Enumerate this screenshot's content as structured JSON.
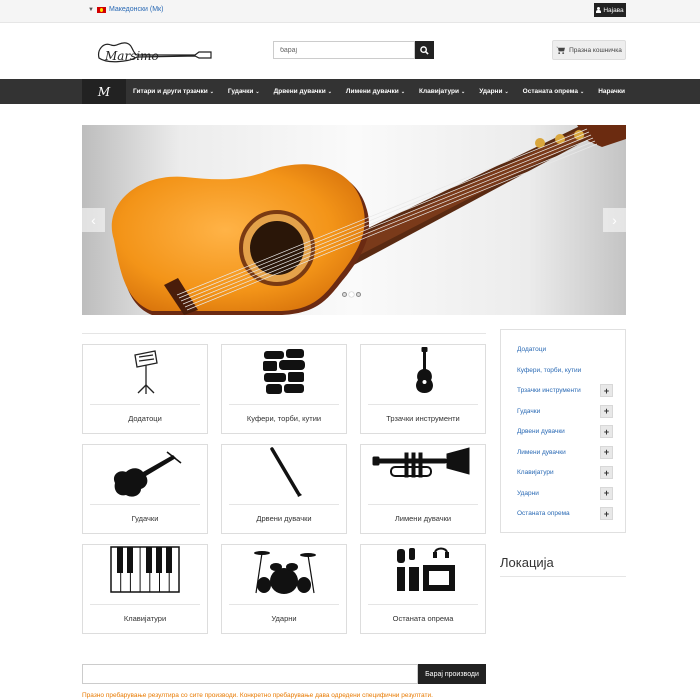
{
  "topbar": {
    "language": "Македонски (Mк)",
    "login_label": "Најава"
  },
  "header": {
    "logo_text": "Marsimo",
    "search_placeholder": "барај",
    "cart_label": "Празна кошничка"
  },
  "nav": {
    "logo_text": "M",
    "items": [
      {
        "label": "Гитари и други трзачки",
        "has_dropdown": true
      },
      {
        "label": "Гудачки",
        "has_dropdown": true
      },
      {
        "label": "Дрвени дувачки",
        "has_dropdown": true
      },
      {
        "label": "Лимени дувачки",
        "has_dropdown": true
      },
      {
        "label": "Клавијатури",
        "has_dropdown": true
      },
      {
        "label": "Ударни",
        "has_dropdown": true
      },
      {
        "label": "Останата опрема",
        "has_dropdown": true
      },
      {
        "label": "Нарачки",
        "has_dropdown": false
      }
    ]
  },
  "slider": {
    "prev_icon": "chevron-left-icon",
    "next_icon": "chevron-right-icon",
    "slide_count": 3,
    "active_slide": 2
  },
  "categories": [
    {
      "label": "Додатоци",
      "icon": "music-stand-icon"
    },
    {
      "label": "Куфери, торби, кутии",
      "icon": "cases-icon"
    },
    {
      "label": "Трзачки инструменти",
      "icon": "guitar-icon"
    },
    {
      "label": "Гудачки",
      "icon": "violin-icon"
    },
    {
      "label": "Дрвени дувачки",
      "icon": "clarinet-icon"
    },
    {
      "label": "Лимени дувачки",
      "icon": "trumpet-icon"
    },
    {
      "label": "Клавијатури",
      "icon": "piano-keys-icon"
    },
    {
      "label": "Ударни",
      "icon": "drum-kit-icon"
    },
    {
      "label": "Останата опрема",
      "icon": "audio-equipment-icon"
    }
  ],
  "sidebar": {
    "items": [
      {
        "label": "Додатоци",
        "expandable": false
      },
      {
        "label": "Куфери, торби, кутии",
        "expandable": false
      },
      {
        "label": "Трзачки инструменти",
        "expandable": true
      },
      {
        "label": "Гудачки",
        "expandable": true
      },
      {
        "label": "Дрвени дувачки",
        "expandable": true
      },
      {
        "label": "Лимени дувачки",
        "expandable": true
      },
      {
        "label": "Клавијатури",
        "expandable": true
      },
      {
        "label": "Ударни",
        "expandable": true
      },
      {
        "label": "Останата опрема",
        "expandable": true
      }
    ],
    "expand_symbol": "+"
  },
  "location": {
    "title": "Локација"
  },
  "bottom_search": {
    "button_label": "Барај производи",
    "hint": "Празно пребарување резултира со сите производи. Конкретно пребарување дава одредени специфични резултати."
  },
  "colors": {
    "link": "#2a6ab5",
    "nav_bg": "#333333",
    "dark_button": "#222222",
    "hint": "#e87a00"
  }
}
